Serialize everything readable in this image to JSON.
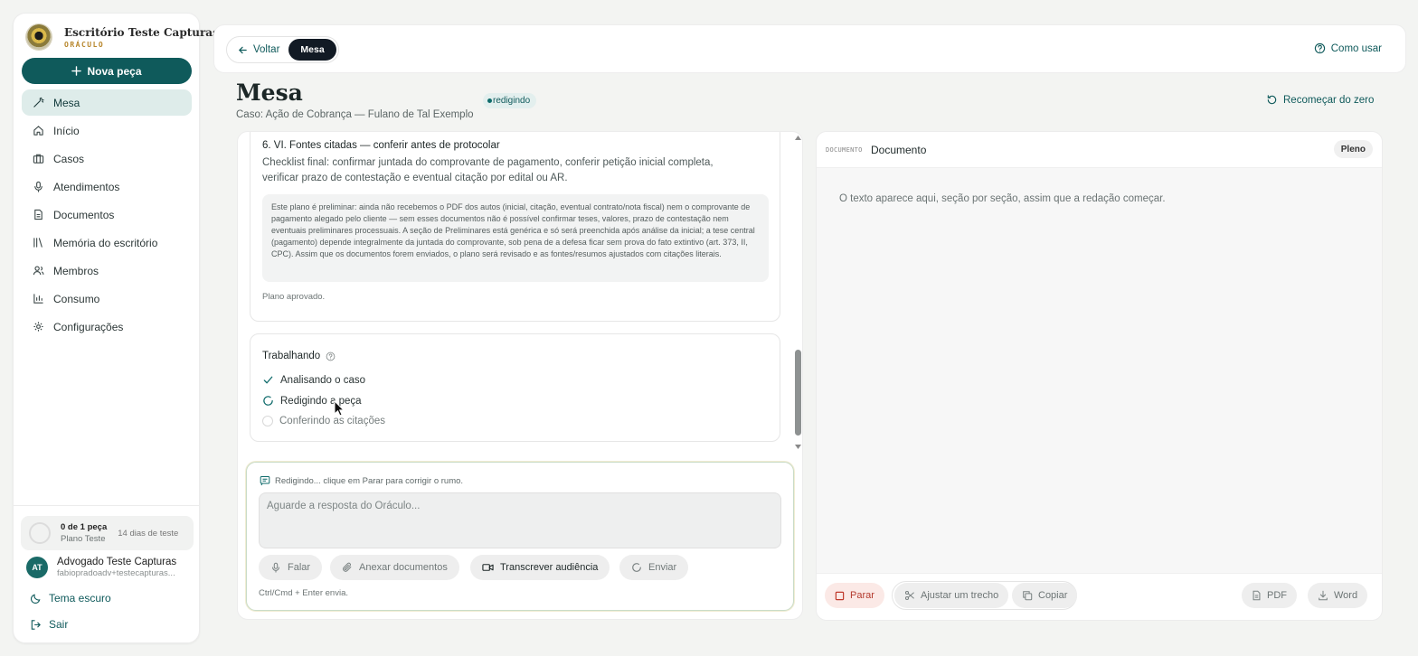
{
  "sidebar": {
    "brand_name": "Escritório Teste Capturas",
    "brand_sub": "ORÁCULO",
    "new_button": "Nova peça",
    "items": [
      {
        "label": "Mesa",
        "icon": "magic-wand-icon",
        "active": true
      },
      {
        "label": "Início",
        "icon": "home-icon"
      },
      {
        "label": "Casos",
        "icon": "briefcase-icon"
      },
      {
        "label": "Atendimentos",
        "icon": "microphone-icon"
      },
      {
        "label": "Documentos",
        "icon": "document-icon"
      },
      {
        "label": "Memória do escritório",
        "icon": "library-icon"
      },
      {
        "label": "Membros",
        "icon": "users-icon"
      },
      {
        "label": "Consumo",
        "icon": "bar-chart-icon"
      },
      {
        "label": "Configurações",
        "icon": "gear-icon"
      }
    ],
    "plan": {
      "count": "0 de 1 peça",
      "name": "Plano Teste",
      "trial": "14 dias de teste"
    },
    "user": {
      "initials": "AT",
      "name": "Advogado Teste Capturas",
      "email": "fabiopradoadv+testecapturas..."
    },
    "theme_link": "Tema escuro",
    "logout_link": "Sair"
  },
  "topbar": {
    "back": "Voltar",
    "active_tab": "Mesa",
    "help": "Como usar"
  },
  "header": {
    "title": "Mesa",
    "case": "Caso: Ação de Cobrança — Fulano de Tal Exemplo",
    "status": "redigindo",
    "restart": "Recomeçar do zero"
  },
  "plan_card": {
    "section_title": "6. VI. Fontes citadas — conferir antes de protocolar",
    "section_text": "Checklist final: confirmar juntada do comprovante de pagamento, conferir petição inicial completa, verificar prazo de contestação e eventual citação por edital ou AR.",
    "note": "Este plano é preliminar: ainda não recebemos o PDF dos autos (inicial, citação, eventual contrato/nota fiscal) nem o comprovante de pagamento alegado pelo cliente — sem esses documentos não é possível confirmar teses, valores, prazo de contestação nem eventuais preliminares processuais. A seção de Preliminares está genérica e só será preenchida após análise da inicial; a tese central (pagamento) depende integralmente da juntada do comprovante, sob pena de a defesa ficar sem prova do fato extintivo (art. 373, II, CPC). Assim que os documentos forem enviados, o plano será revisado e as fontes/resumos ajustados com citações literais.",
    "approved": "Plano aprovado."
  },
  "working": {
    "title": "Trabalhando",
    "steps": [
      {
        "label": "Analisando o caso",
        "state": "done"
      },
      {
        "label": "Redigindo a peça",
        "state": "in-progress"
      },
      {
        "label": "Conferindo as citações",
        "state": "pending"
      }
    ]
  },
  "composer": {
    "hint": "Redigindo... clique em Parar para corrigir o rumo.",
    "placeholder": "Aguarde a resposta do Oráculo...",
    "speak": "Falar",
    "attach": "Anexar documentos",
    "transcribe": "Transcrever audiência",
    "send": "Enviar",
    "shortcut": "Ctrl/Cmd + Enter envia."
  },
  "document": {
    "kicker": "DOCUMENTO",
    "title": "Documento",
    "mode": "Pleno",
    "placeholder": "O texto aparece aqui, seção por seção, assim que a redação começar.",
    "stop": "Parar",
    "adjust": "Ajustar um trecho",
    "copy": "Copiar",
    "pdf": "PDF",
    "word": "Word"
  },
  "colors": {
    "accent": "#0f5a5b",
    "badge_bg": "#e3efee",
    "stop": "#b43a2e"
  }
}
